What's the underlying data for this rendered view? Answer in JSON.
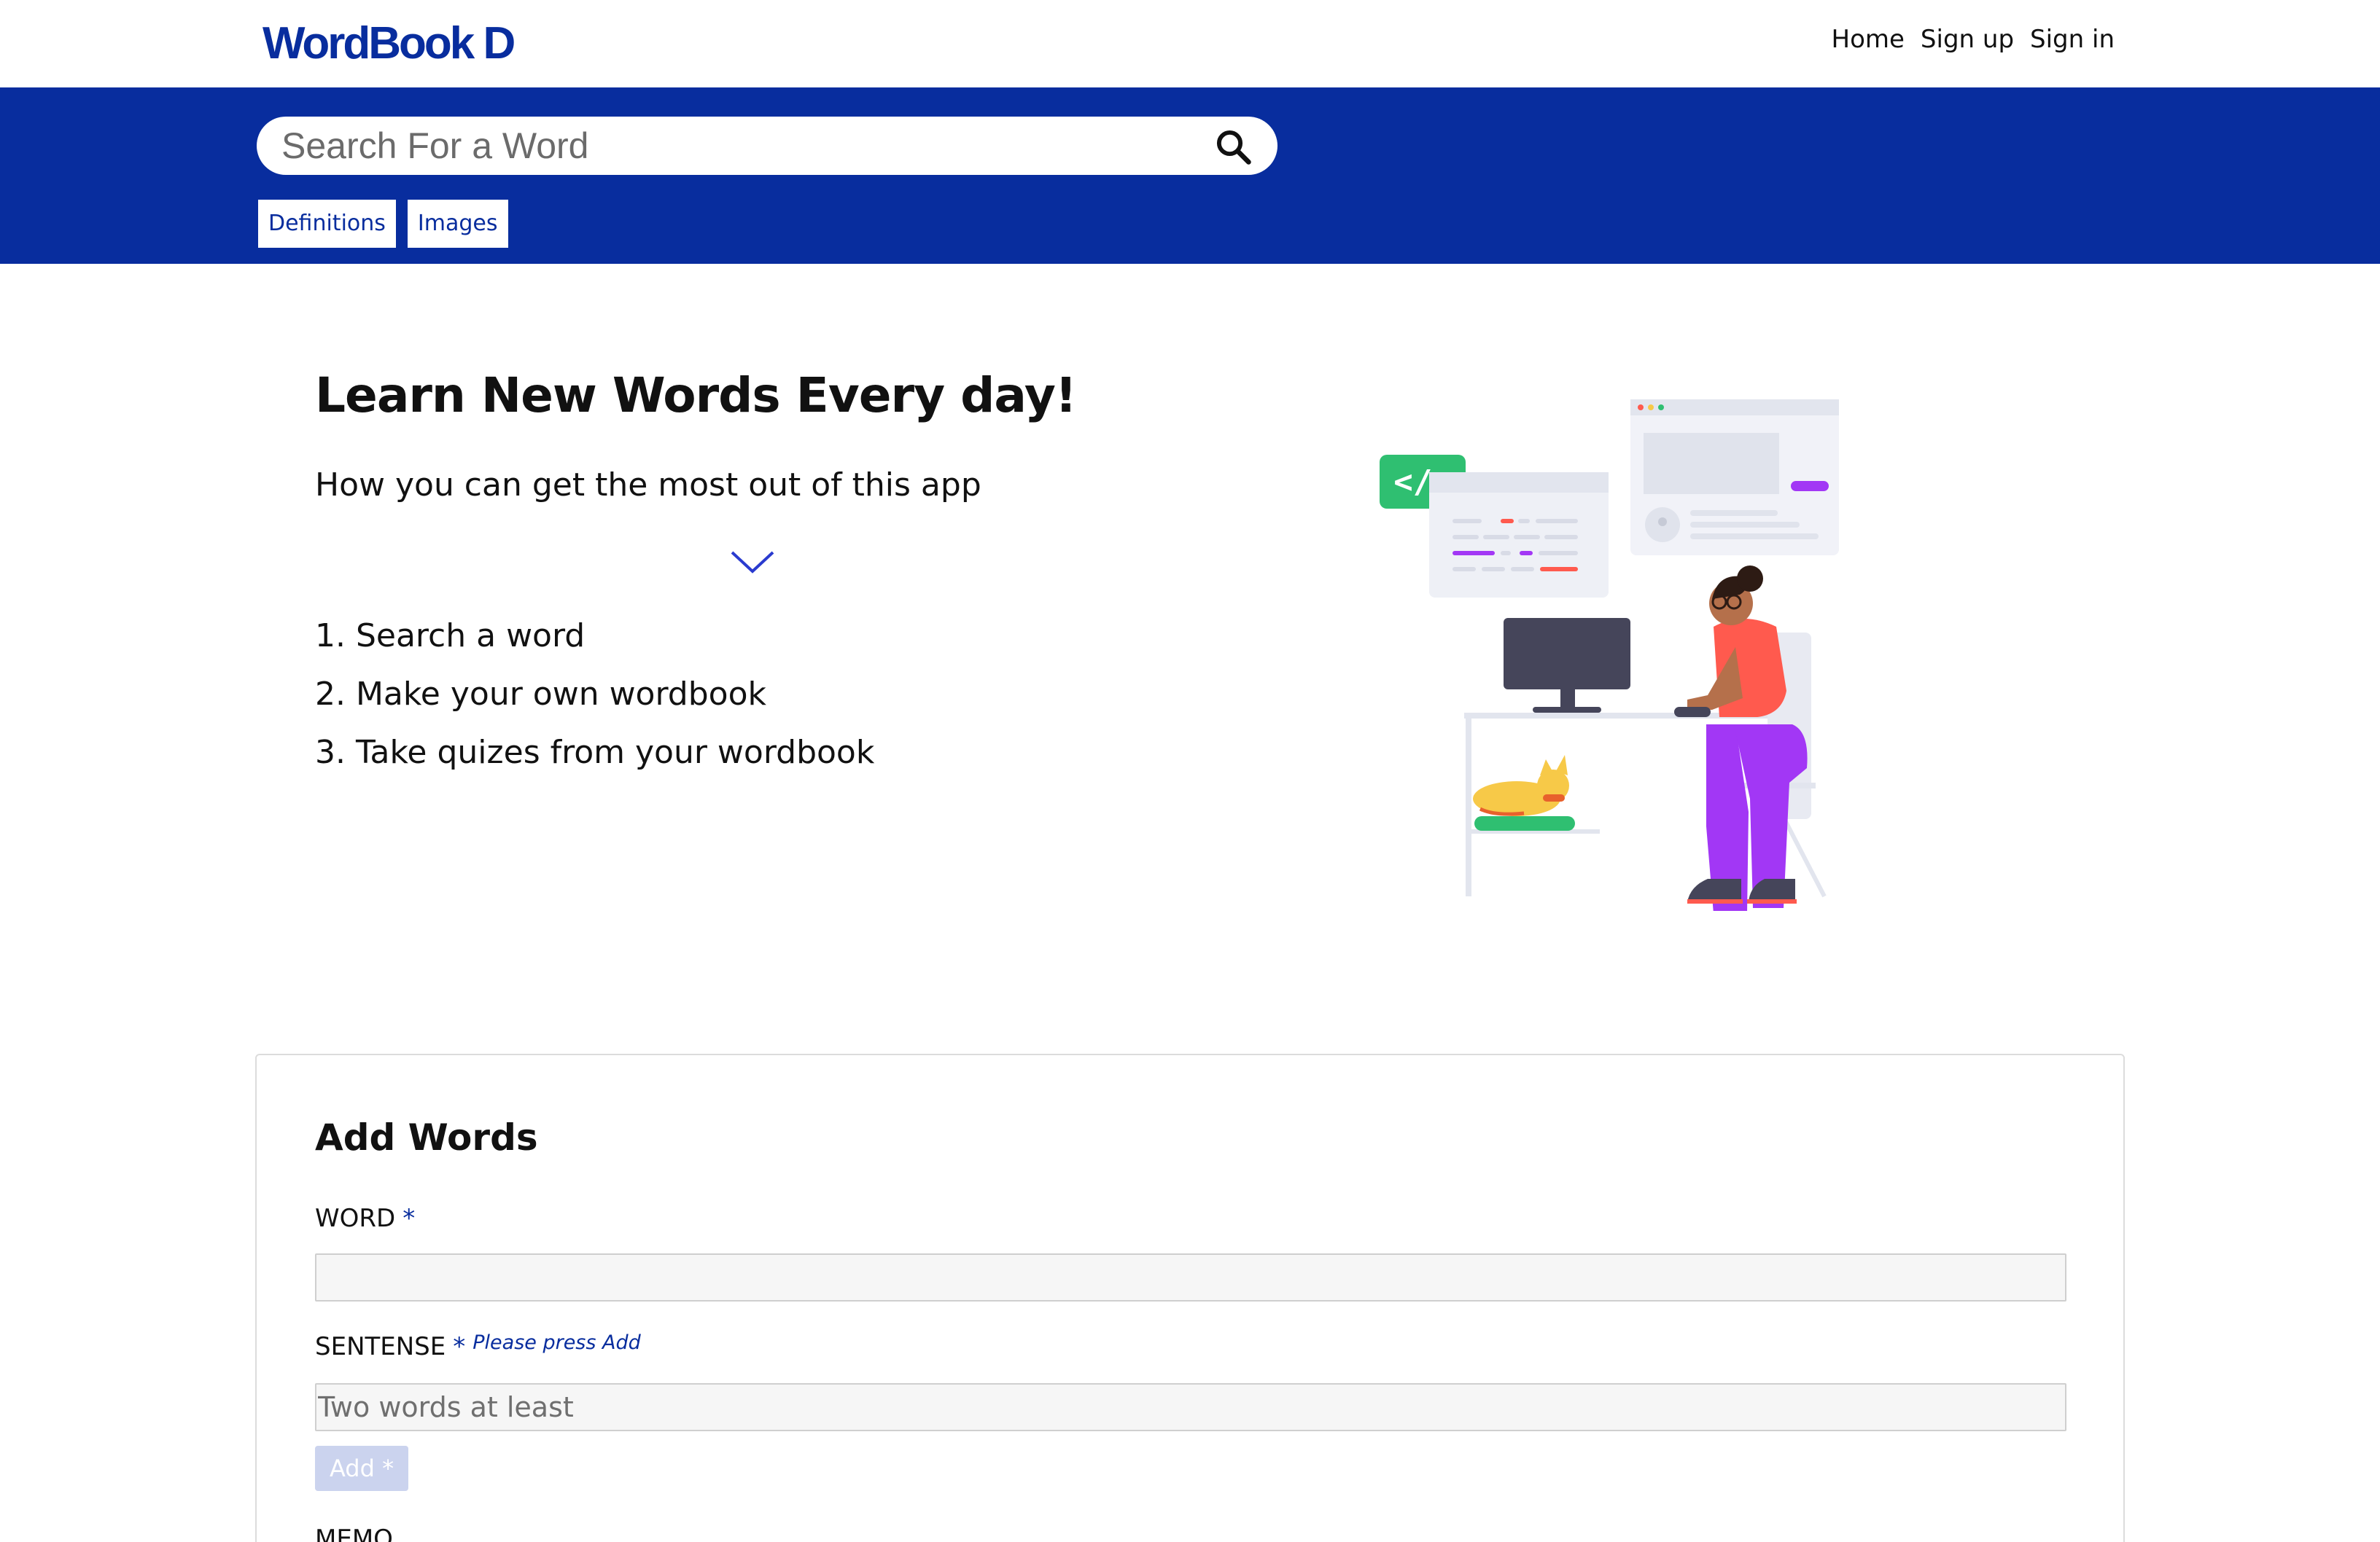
{
  "header": {
    "logo": "WordBook D",
    "nav": [
      "Home",
      "Sign up",
      "Sign in"
    ]
  },
  "search": {
    "placeholder": "Search For a Word",
    "tabs": [
      "Definitions",
      "Images"
    ]
  },
  "hero": {
    "title": "Learn New Words Every day!",
    "subtitle": "How you can get the most out of this app",
    "steps": [
      "1. Search a word",
      "2. Make your own wordbook",
      "3. Take quizes from your wordbook"
    ]
  },
  "form": {
    "title": "Add Words",
    "word_label": "WORD",
    "required_mark": "*",
    "sentence_label": "SENTENSE",
    "sentence_hint": "Please press Add",
    "sentence_placeholder": "Two words at least",
    "add_label": "Add *",
    "memo_label": "MEMO"
  },
  "colors": {
    "brand": "#082d9e",
    "illus_green": "#2fbf71",
    "illus_purple": "#a237f5",
    "illus_coral": "#ff5a4e"
  },
  "icons": [
    "search-icon",
    "chevron-down-icon"
  ]
}
